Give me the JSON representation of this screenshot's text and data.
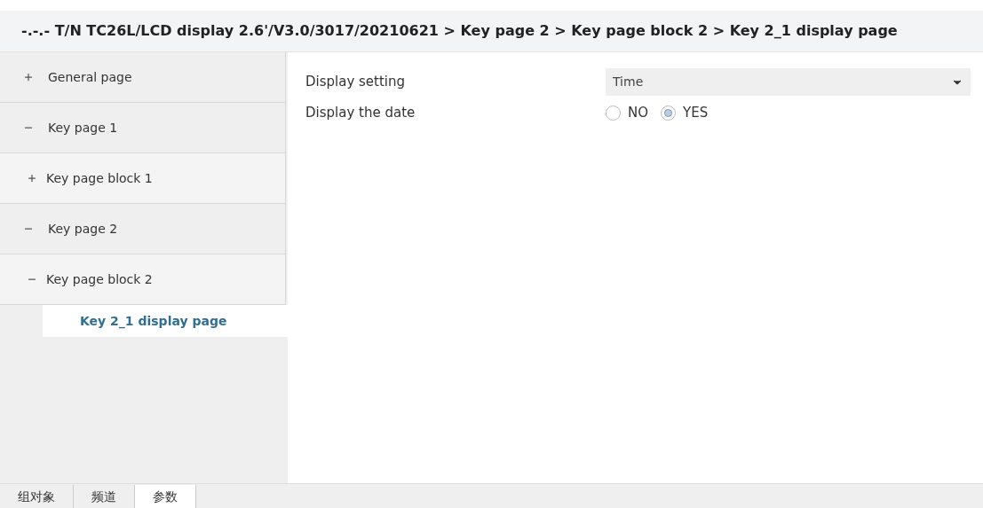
{
  "breadcrumb": "-.-.- T/N TC26L/LCD display 2.6'/V3.0/3017/20210621 > Key page 2 > Key page block 2 > Key 2_1 display page",
  "tree": [
    {
      "label": "General page",
      "expanded": false,
      "selected": false
    },
    {
      "label": "Key page 1",
      "expanded": true,
      "selected": false,
      "children": [
        {
          "label": "Key page block 1",
          "expanded": false,
          "selected": false
        }
      ]
    },
    {
      "label": "Key page 2",
      "expanded": true,
      "selected": false,
      "children": [
        {
          "label": "Key page block 2",
          "expanded": true,
          "selected": false,
          "children": [
            {
              "label": "Key 2_1 display page",
              "selected": true
            }
          ]
        }
      ]
    }
  ],
  "parameters": [
    {
      "kind": "dropdown",
      "label": "Display setting",
      "value": "Time"
    },
    {
      "kind": "radio",
      "label": "Display the date",
      "options": [
        {
          "label": "NO",
          "selected": false
        },
        {
          "label": "YES",
          "selected": true
        }
      ]
    }
  ],
  "bottom_tabs": [
    {
      "label": "组对象",
      "selected": false
    },
    {
      "label": "频道",
      "selected": false
    },
    {
      "label": "参数",
      "selected": true
    }
  ]
}
